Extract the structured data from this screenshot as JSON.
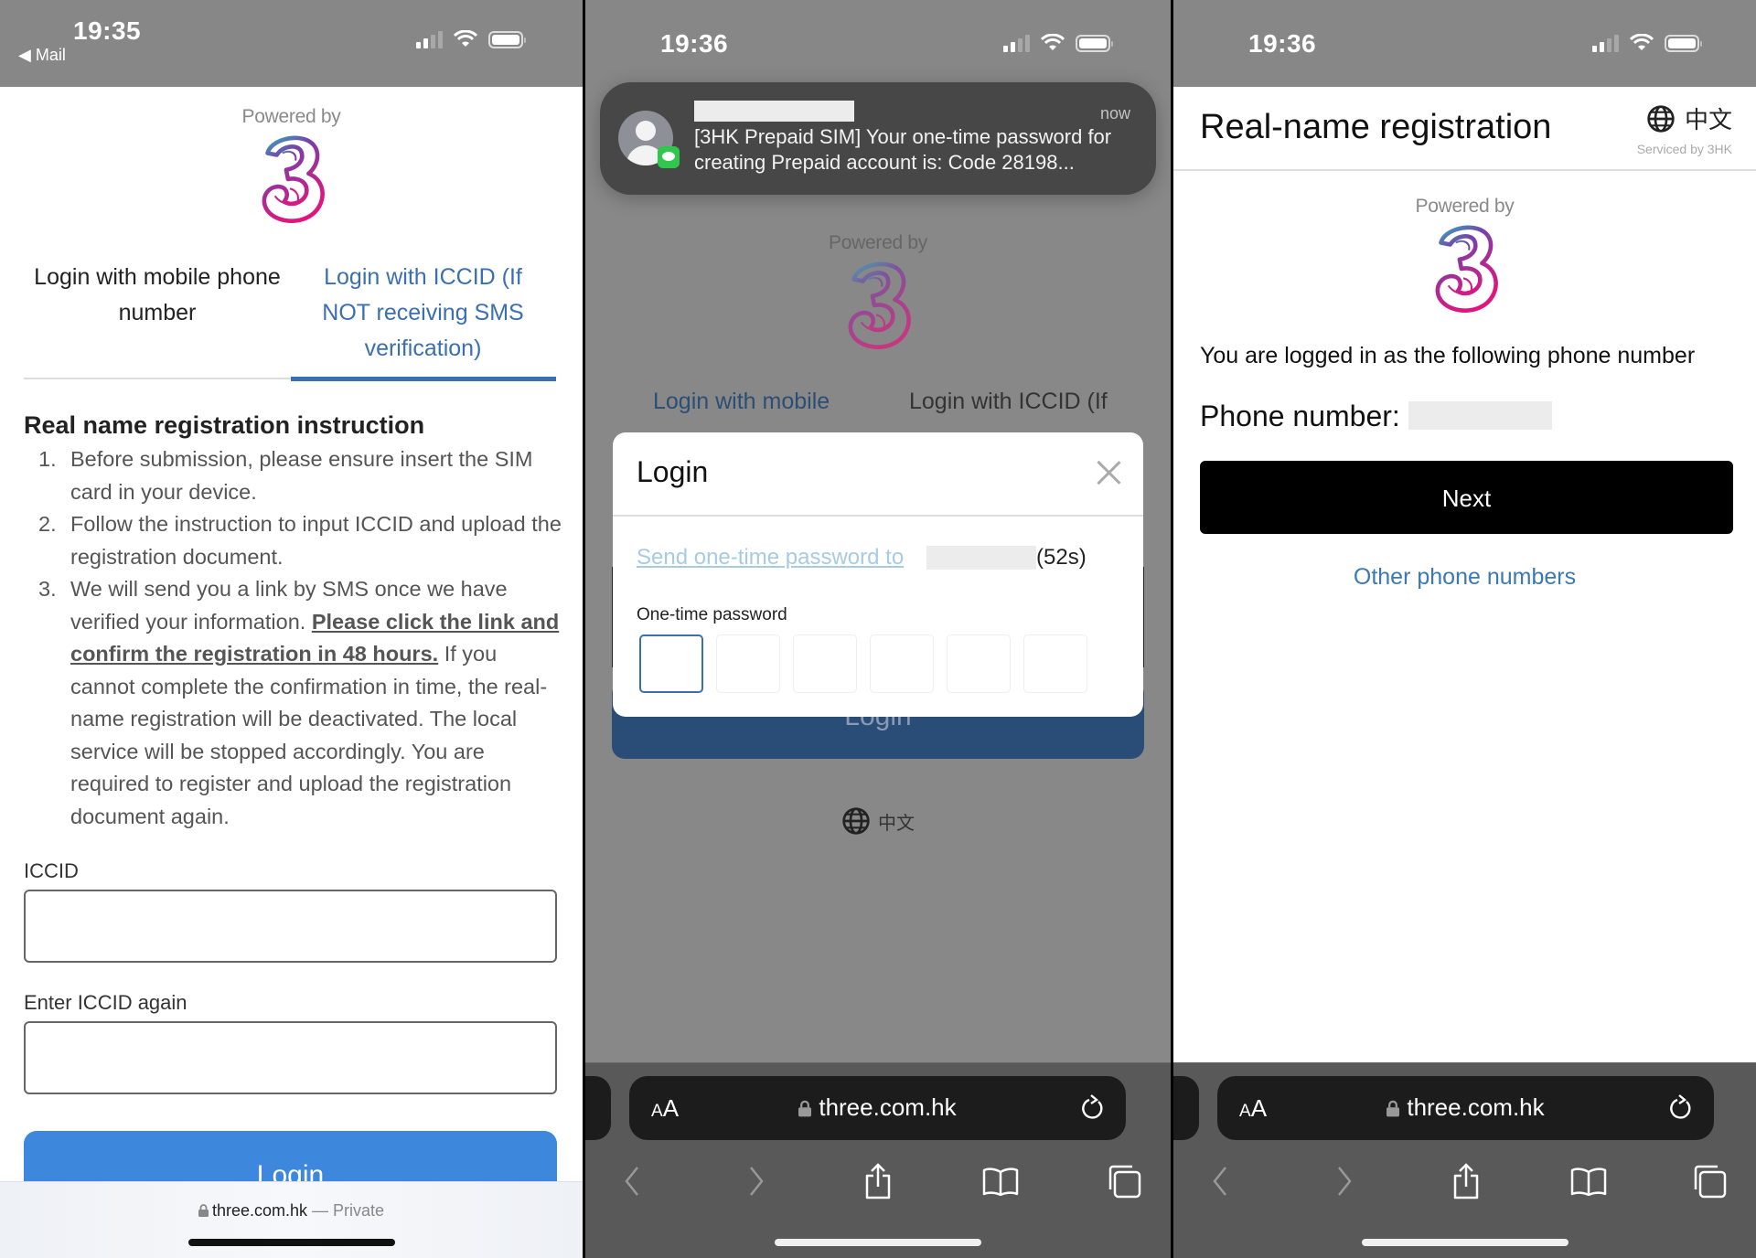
{
  "panels": [
    {
      "status": {
        "time": "19:35",
        "back_label": "◀ Mail"
      },
      "powered_by": "Powered by",
      "tabs": [
        {
          "label": "Login with mobile phone number",
          "active": false
        },
        {
          "label": "Login with ICCID (If NOT receiving SMS verification)",
          "active": true
        }
      ],
      "instructions": {
        "title": "Real name registration instruction",
        "items": [
          {
            "num": "1.",
            "text": "Before submission, please ensure insert the SIM card in your device."
          },
          {
            "num": "2.",
            "text": "Follow the instruction to input ICCID and upload the registration document."
          },
          {
            "num": "3.",
            "text_before": "We will send you a link by SMS once we have verified your information. ",
            "link": "Please click the link and confirm the registration in 48 hours.",
            "text_after": " If you cannot complete the confirmation in time, the real-name registration will be deactivated. The local service will be stopped accordingly. You are required to register and upload the registration document again."
          }
        ]
      },
      "form": {
        "iccid_label": "ICCID",
        "iccid_value": "",
        "iccid_again_label": "Enter ICCID again",
        "iccid_again_value": "",
        "login_label": "Login"
      },
      "safari": {
        "domain": "three.com.hk",
        "separator": " — ",
        "mode": "Private"
      }
    },
    {
      "status": {
        "time": "19:36"
      },
      "notification": {
        "time": "now",
        "message": "[3HK Prepaid SIM] Your one-time password for creating Prepaid account is: Code 28198..."
      },
      "powered_by": "Powered by",
      "tabs": [
        {
          "label": "Login with mobile",
          "active": true
        },
        {
          "label": "Login with ICCID (If",
          "active": false
        }
      ],
      "modal": {
        "title": "Login",
        "send_link": "Send one-time password to",
        "countdown": "(52s)",
        "otp_label": "One-time password",
        "otp_digits": [
          "",
          "",
          "",
          "",
          "",
          ""
        ]
      },
      "login_label": "Login",
      "language": "中文",
      "safari": {
        "aa_small": "A",
        "aa_large": "A",
        "domain": "three.com.hk"
      }
    },
    {
      "status": {
        "time": "19:36"
      },
      "header": {
        "title": "Real-name registration",
        "language": "中文",
        "serviced_by": "Serviced by 3HK"
      },
      "powered_by": "Powered by",
      "logged_in_text": "You are logged in as the following phone number",
      "phone_label": "Phone number:",
      "next_label": "Next",
      "other_numbers_label": "Other phone numbers",
      "safari": {
        "aa_small": "A",
        "aa_large": "A",
        "domain": "three.com.hk"
      }
    }
  ],
  "colors": {
    "brand_blue": "#3d87dc",
    "tab_active": "#3b6fb0",
    "link_blue": "#3a79b5",
    "status_bar": "#878787",
    "safari_dark": "#595959"
  }
}
